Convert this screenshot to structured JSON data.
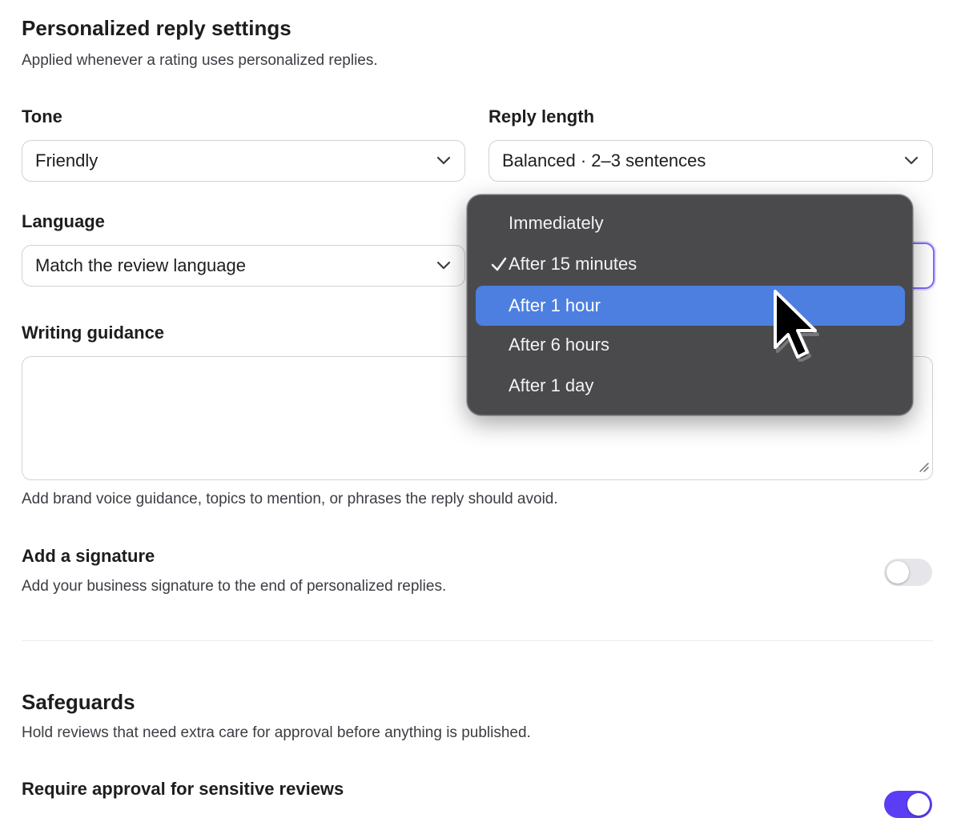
{
  "section1": {
    "title": "Personalized reply settings",
    "subtitle": "Applied whenever a rating uses personalized replies."
  },
  "tone": {
    "label": "Tone",
    "value": "Friendly"
  },
  "reply_length": {
    "label": "Reply length",
    "value": "Balanced · 2–3 sentences"
  },
  "language": {
    "label": "Language",
    "value": "Match the review language"
  },
  "writing_guidance": {
    "label": "Writing guidance",
    "value": "",
    "helper": "Add brand voice guidance, topics to mention, or phrases the reply should avoid."
  },
  "signature": {
    "label": "Add a signature",
    "description": "Add your business signature to the end of personalized replies.",
    "enabled": false
  },
  "safeguards": {
    "title": "Safeguards",
    "subtitle": "Hold reviews that need extra care for approval before anything is published.",
    "require_approval_label": "Require approval for sensitive reviews",
    "require_approval_enabled": true
  },
  "delay_menu": {
    "options": [
      "Immediately",
      "After 15 minutes",
      "After 1 hour",
      "After 6 hours",
      "After 1 day"
    ],
    "checked": "After 15 minutes",
    "highlighted": "After 1 hour"
  },
  "icons": {
    "chevron": "chevron-down-icon",
    "check": "checkmark-icon",
    "cursor": "mouse-pointer-icon",
    "resize": "resize-handle-icon"
  },
  "colors": {
    "accent": "#5b3df5",
    "menu_bg": "#4a4a4d",
    "menu_highlight": "#4c7fe0",
    "toggle_off": "#e5e5ea"
  }
}
